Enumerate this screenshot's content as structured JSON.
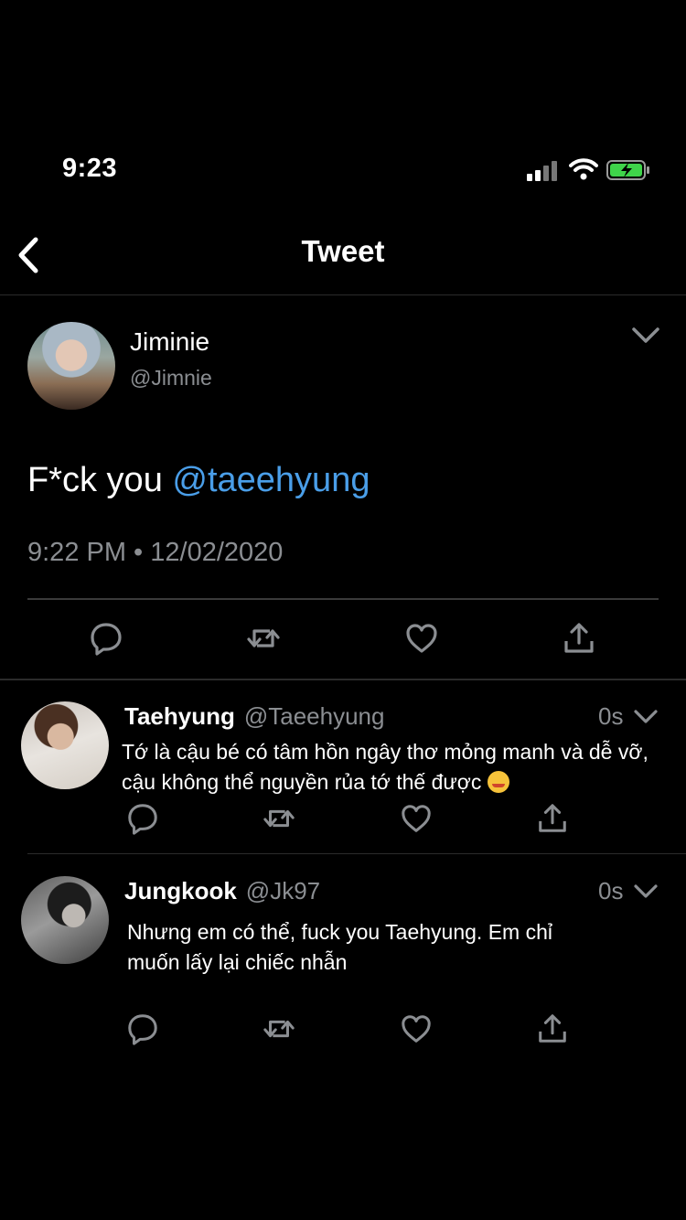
{
  "status_bar": {
    "time": "9:23"
  },
  "header": {
    "title": "Tweet"
  },
  "tweet": {
    "author_name": "Jiminie",
    "author_handle": "@Jimnie",
    "text_plain": "F*ck you ",
    "text_mention": "@taeehyung",
    "timestamp": "9:22 PM • 12/02/2020"
  },
  "replies": [
    {
      "name": "Taehyung",
      "handle": "@Taeehyung",
      "time": "0s",
      "line1": "Tớ là cậu bé có tâm hồn ngây thơ mỏng manh và dễ vỡ,",
      "line2": "cậu không thể nguyền rủa tớ thế được"
    },
    {
      "name": "Jungkook",
      "handle": "@Jk97",
      "time": "0s",
      "line1": "Nhưng em có thể, fuck you Taehyung. Em chỉ",
      "line2": "muốn lấy lại chiếc nhẫn"
    }
  ],
  "colors": {
    "background": "#000000",
    "link": "#4a9ee8",
    "secondary_text": "#8b8e92"
  },
  "icons": [
    "reply-icon",
    "retweet-icon",
    "like-icon",
    "share-icon"
  ]
}
